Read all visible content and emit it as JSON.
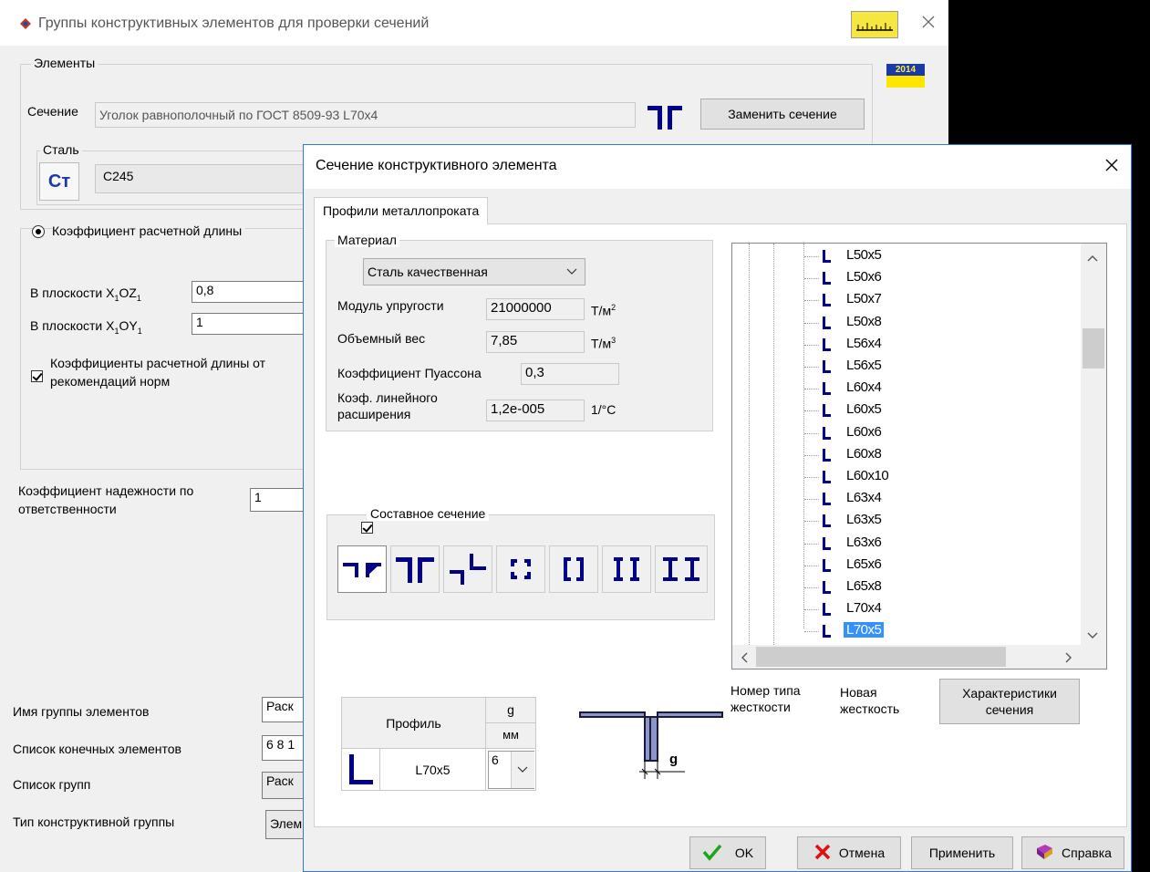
{
  "main": {
    "title": "Группы конструктивных элементов для проверки сечений",
    "elements_group": "Элементы",
    "section_label": "Сечение",
    "section_value": "Уголок равнополочный по ГОСТ 8509-93 L70x4",
    "replace_section_button": "Заменить сечение",
    "steel_group": "Сталь",
    "steel_icon_text": "Ст",
    "steel_value": "С245",
    "year_badge": "2014",
    "length_coef_radio": "Коэффициент расчетной длины",
    "plane_xoz_label": "В плоскости X",
    "plane_xoz_sub": "1",
    "plane_xoz_tail": "OZ",
    "plane_xoz_value": "0,8",
    "plane_xoy_label": "В плоскости X",
    "plane_xoy_sub": "1",
    "plane_xoy_tail": "OY",
    "plane_xoy_value": "1",
    "norm_checkbox_line1": "Коэффициенты расчетной длины от",
    "norm_checkbox_line2": "рекомендаций норм",
    "reliability_label_line1": "Коэффициент надежности по",
    "reliability_label_line2": "ответственности",
    "reliability_value": "1",
    "group_name_label": "Имя группы элементов",
    "group_name_value": "Раск",
    "fe_list_label": "Список конечных элементов",
    "fe_list_value": "6 8 1",
    "groups_list_label": "Список групп",
    "groups_list_value": "Раск",
    "group_type_label": "Тип конструктивной группы",
    "group_type_value": "Элем"
  },
  "dialog": {
    "title": "Сечение конструктивного элемента",
    "tab": "Профили металлопроката",
    "material_group": "Материал",
    "material_value": "Сталь качественная",
    "modulus_label": "Модуль упругости",
    "modulus_value": "21000000",
    "modulus_unit": "Т/м",
    "modulus_unit_sup": "2",
    "weight_label": "Объемный вес",
    "weight_value": "7,85",
    "weight_unit": "Т/м",
    "weight_unit_sup": "3",
    "poisson_label": "Коэффициент Пуассона",
    "poisson_value": "0,3",
    "expansion_label_line1": "Коэф. линейного",
    "expansion_label_line2": "расширения",
    "expansion_value": "1,2e-005",
    "expansion_unit": "1/°C",
    "composite_checkbox": "Составное сечение",
    "profile_header": "Профиль",
    "g_header": "g",
    "mm_header": "мм",
    "profile_value": "L70x5",
    "g_value": "6",
    "preview_g_label": "g",
    "stiffness_type_label_line1": "Номер типа",
    "stiffness_type_label_line2": "жесткости",
    "new_stiffness_line1": "Новая",
    "new_stiffness_line2": "жесткость",
    "characteristics_button_line1": "Характеристики",
    "characteristics_button_line2": "сечения",
    "ok_button": "OK",
    "cancel_button": "Отмена",
    "apply_button": "Применить",
    "help_button": "Справка",
    "tree_items": [
      "L50x5",
      "L50x6",
      "L50x7",
      "L50x8",
      "L56x4",
      "L56x5",
      "L60x4",
      "L60x5",
      "L60x6",
      "L60x8",
      "L60x10",
      "L63x4",
      "L63x5",
      "L63x6",
      "L65x6",
      "L65x8",
      "L70x4",
      "L70x5"
    ],
    "selected_item": "L70x5"
  }
}
